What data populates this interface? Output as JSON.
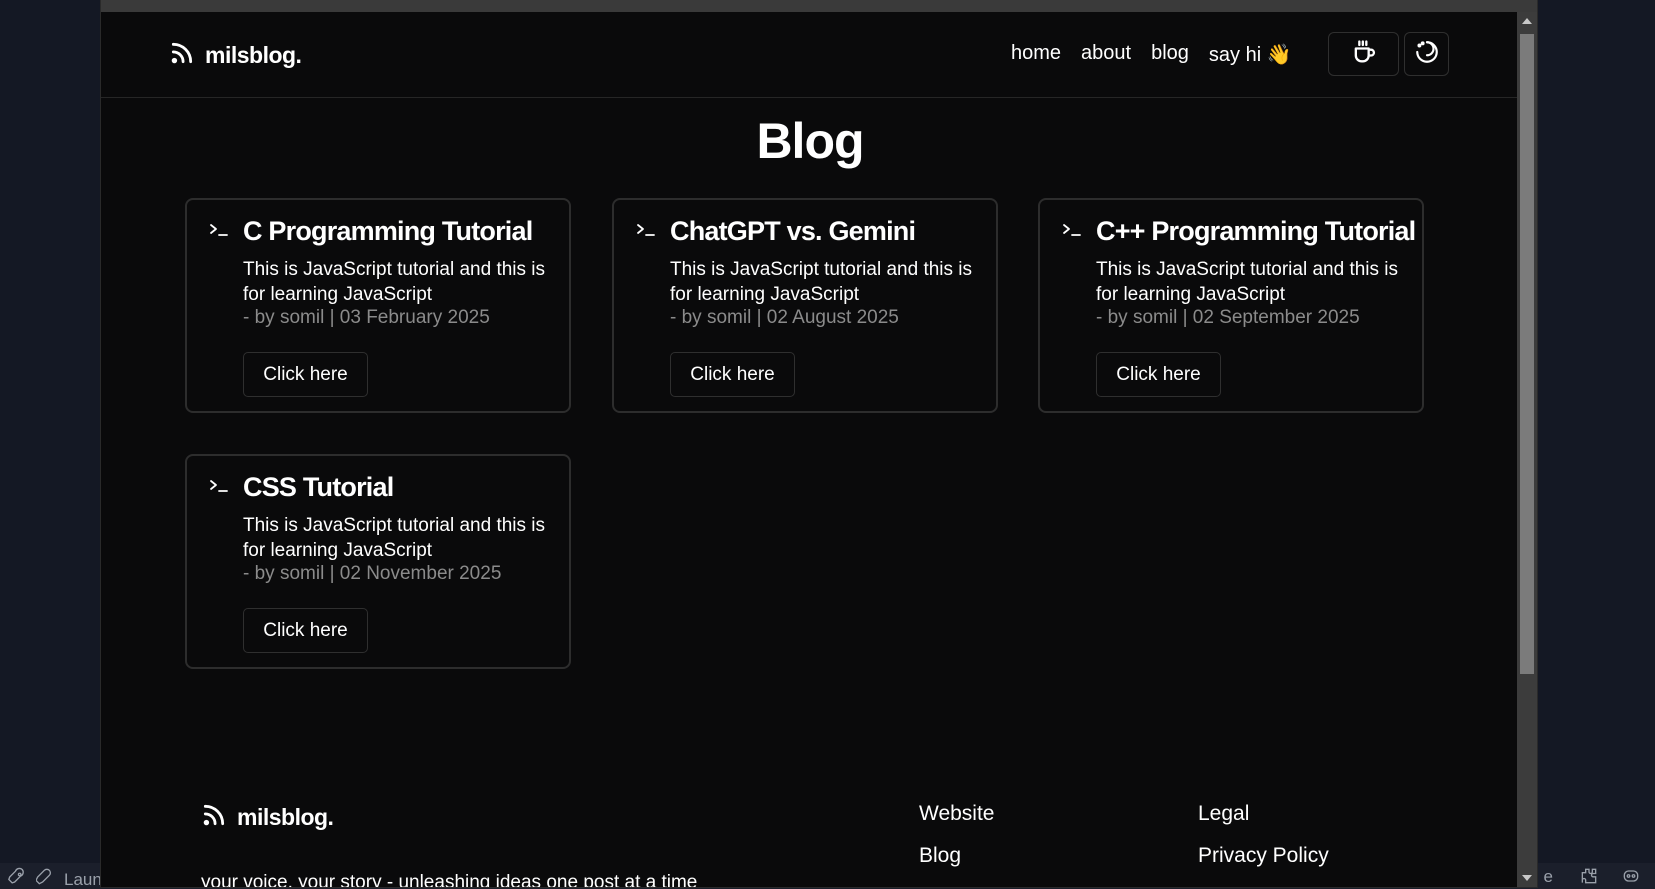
{
  "background": {
    "taskbar_left_text": "Launc",
    "taskbar_right_text": "e",
    "icons": [
      "rocket-icon",
      "rocket-outline-icon",
      "extension-icon",
      "copilot-icon"
    ]
  },
  "header": {
    "brand": "milsblog.",
    "nav": [
      "home",
      "about",
      "blog",
      "say hi 👋"
    ],
    "buttons": [
      "coffee-icon",
      "theme-toggle-icon"
    ]
  },
  "main": {
    "title": "Blog",
    "posts": [
      {
        "title": "C Programming Tutorial",
        "description": "This is JavaScript tutorial and this is for learning JavaScript",
        "meta": "- by somil | 03 February 2025",
        "button": "Click here"
      },
      {
        "title": "ChatGPT vs. Gemini",
        "description": "This is JavaScript tutorial and this is for learning JavaScript",
        "meta": "- by somil | 02 August 2025",
        "button": "Click here"
      },
      {
        "title": "C++ Programming Tutorial",
        "description": "This is JavaScript tutorial and this is for learning JavaScript",
        "meta": "- by somil | 02 September 2025",
        "button": "Click here"
      },
      {
        "title": "CSS Tutorial",
        "description": "This is JavaScript tutorial and this is for learning JavaScript",
        "meta": "- by somil | 02 November 2025",
        "button": "Click here"
      }
    ]
  },
  "footer": {
    "brand": "milsblog.",
    "tagline": "your voice, your story - unleashing ideas one post at a time",
    "website_column": [
      "Website",
      "Blog"
    ],
    "legal_column": [
      "Legal",
      "Privacy Policy"
    ]
  },
  "colors": {
    "page_bg": "#0a0a0b",
    "text": "#ffffff",
    "muted": "#8b8b8b",
    "border": "#2d2d2d"
  }
}
